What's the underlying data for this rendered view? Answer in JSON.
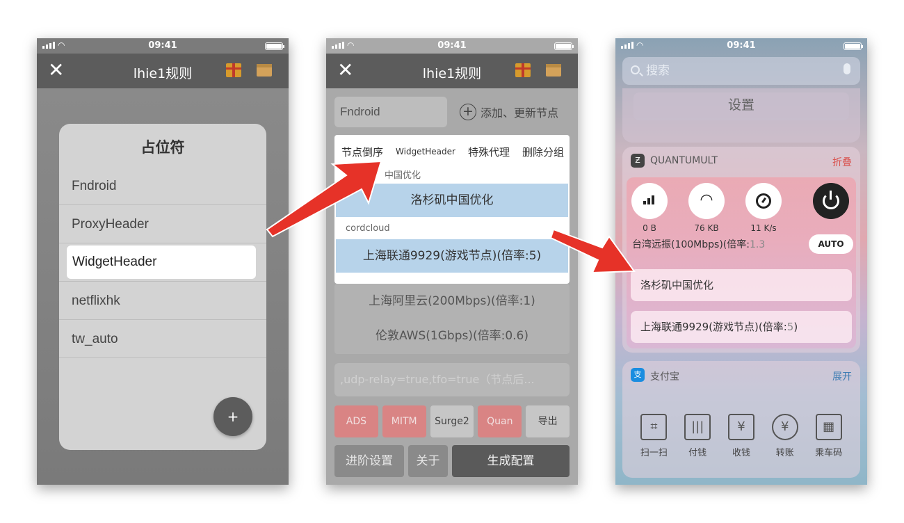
{
  "status": {
    "time": "09:41"
  },
  "navbar": {
    "title": "lhie1规则"
  },
  "phone1": {
    "dialog_title": "占位符",
    "items": [
      "Fndroid",
      "ProxyHeader",
      "WidgetHeader",
      "netflixhk",
      "tw_auto"
    ],
    "selected": "WidgetHeader",
    "fab_label": "+"
  },
  "phone2": {
    "input_value": "Fndroid",
    "add_label": "添加、更新节点",
    "tabs": [
      "节点倒序",
      "WidgetHeader",
      "特殊代理",
      "删除分组"
    ],
    "group1_label": "中国优化",
    "node1": "洛杉矶中国优化",
    "group2_label": "cordcloud",
    "node2": "上海联通9929(游戏节点)(倍率:5)",
    "more_nodes": [
      "上海阿里云(200Mbps)(倍率:1)",
      "伦敦AWS(1Gbps)(倍率:0.6)"
    ],
    "textarea_placeholder": ",udp-relay=true,tfo=true（节点后...",
    "buttons_row1": [
      "ADS",
      "MITM",
      "Surge2",
      "Quan",
      "导出"
    ],
    "buttons_row2": [
      "进阶设置",
      "关于",
      "生成配置"
    ]
  },
  "phone3": {
    "search_placeholder": "搜索",
    "settings_label": "设置",
    "quantumult": {
      "app_name": "QUANTUMULT",
      "action": "折叠",
      "stats": [
        {
          "icon": "signal-bars-icon",
          "label": "0 B"
        },
        {
          "icon": "wifi-icon",
          "label": "76 KB"
        },
        {
          "icon": "speed-gauge-icon",
          "label": "11 K/s"
        }
      ],
      "current_node": "台湾远振(100Mbps)(倍率:",
      "current_rate": "1.3",
      "auto_label": "AUTO",
      "node1": "洛杉矶中国优化",
      "node2_main": "上海联通9929(游戏节点)(倍率:",
      "node2_rate": "5",
      "node2_end": ")"
    },
    "alipay": {
      "app_name": "支付宝",
      "action": "展开",
      "items": [
        "扫一扫",
        "付钱",
        "收钱",
        "转账",
        "乘车码"
      ]
    }
  },
  "colors": {
    "arrow": "#e63228",
    "highlight": "#b7d3ea",
    "accent_red": "#d9534f"
  }
}
